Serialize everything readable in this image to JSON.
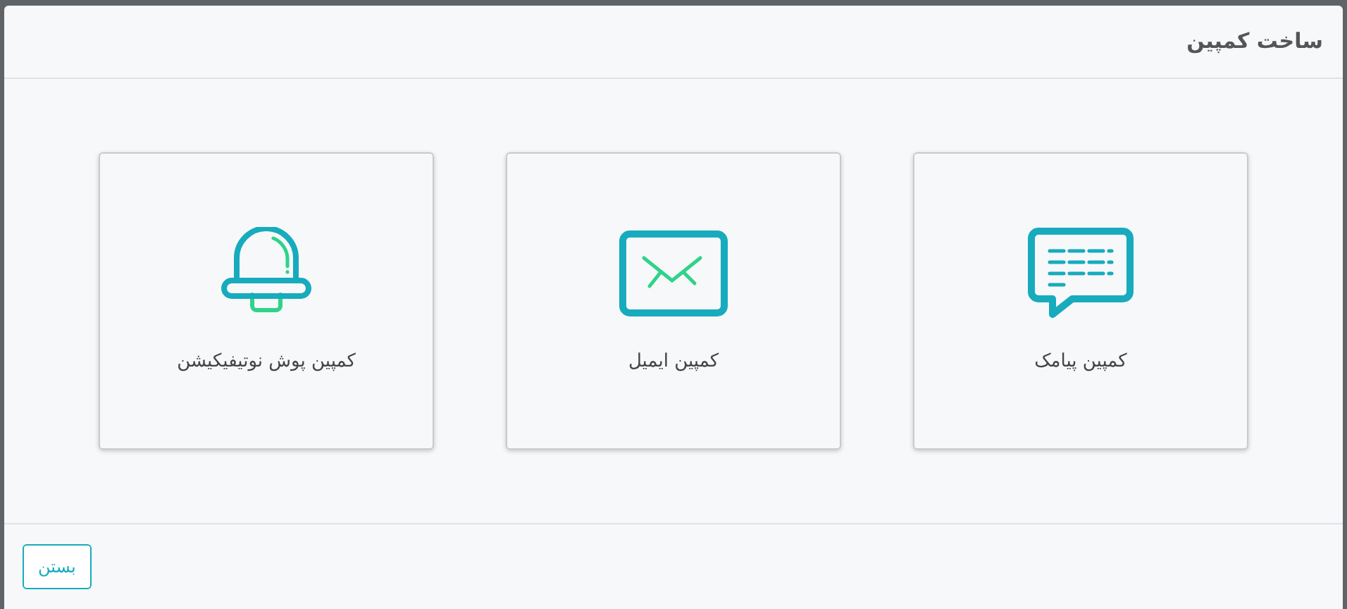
{
  "dialog": {
    "title": "ساخت کمپین"
  },
  "options": [
    {
      "kind": "sms",
      "label": "کمپین پیامک"
    },
    {
      "kind": "email",
      "label": "کمپین ایمیل"
    },
    {
      "kind": "push",
      "label": "کمپین پوش نوتیفیکیشن"
    }
  ],
  "footer": {
    "close_button": "بستن"
  }
}
